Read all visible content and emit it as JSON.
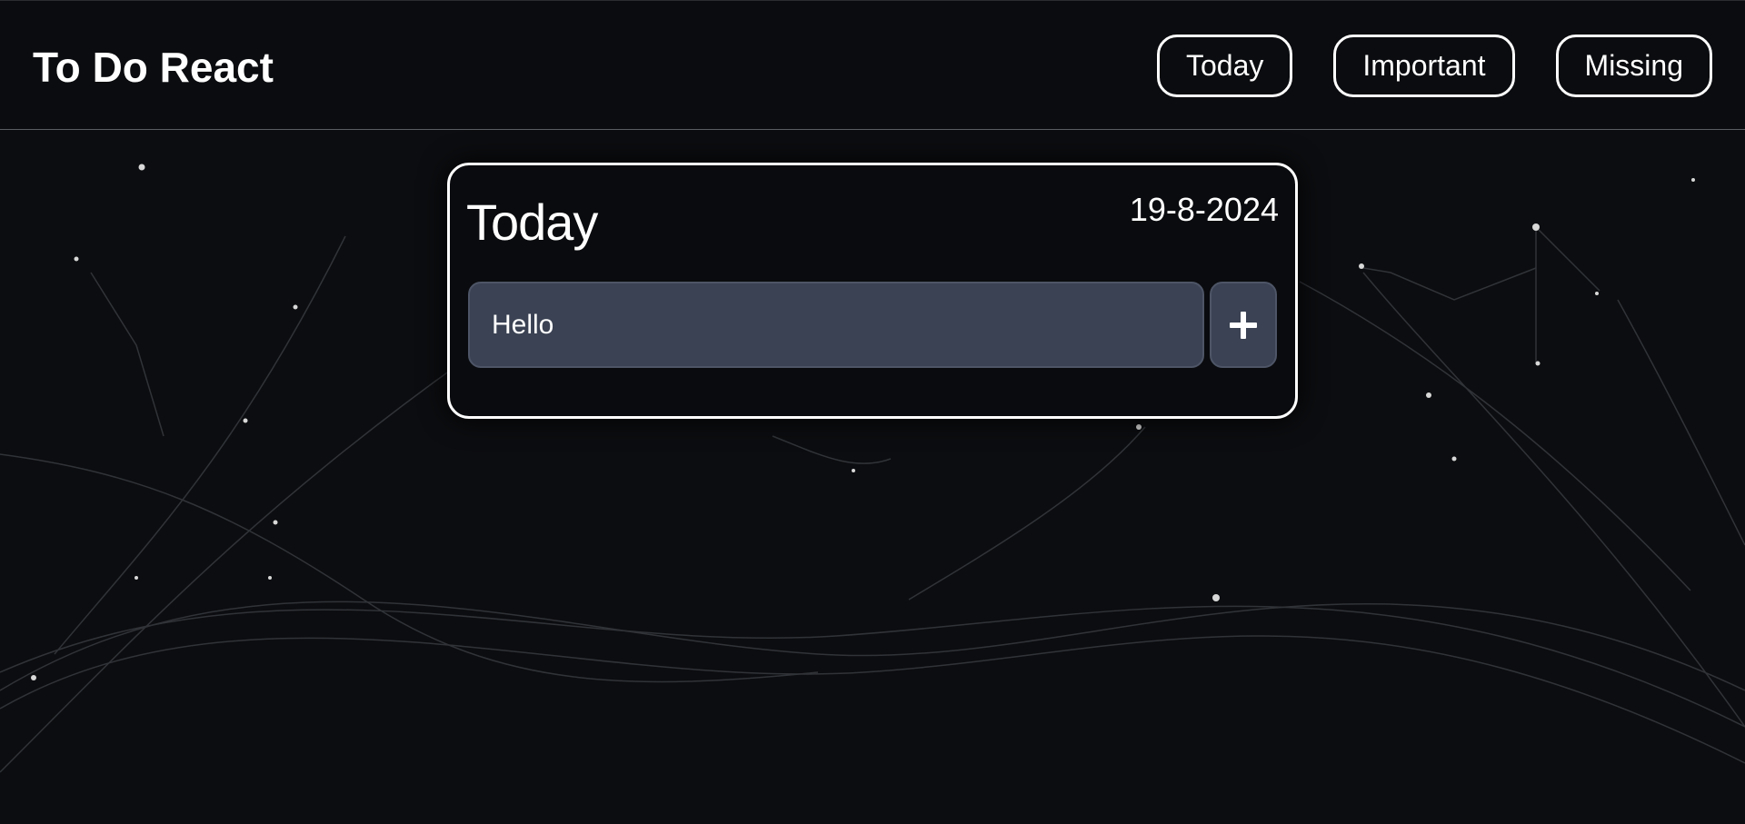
{
  "header": {
    "brand": "To Do React",
    "nav": [
      {
        "label": "Today"
      },
      {
        "label": "Important"
      },
      {
        "label": "Missing"
      }
    ]
  },
  "card": {
    "title": "Today",
    "date": "19-8-2024",
    "input": {
      "value": "Hello",
      "placeholder": ""
    },
    "add_icon": "plus-icon"
  },
  "colors": {
    "background": "#0c0d10",
    "input_bg": "#3a4253",
    "border": "#ffffff",
    "text": "#ffffff"
  }
}
